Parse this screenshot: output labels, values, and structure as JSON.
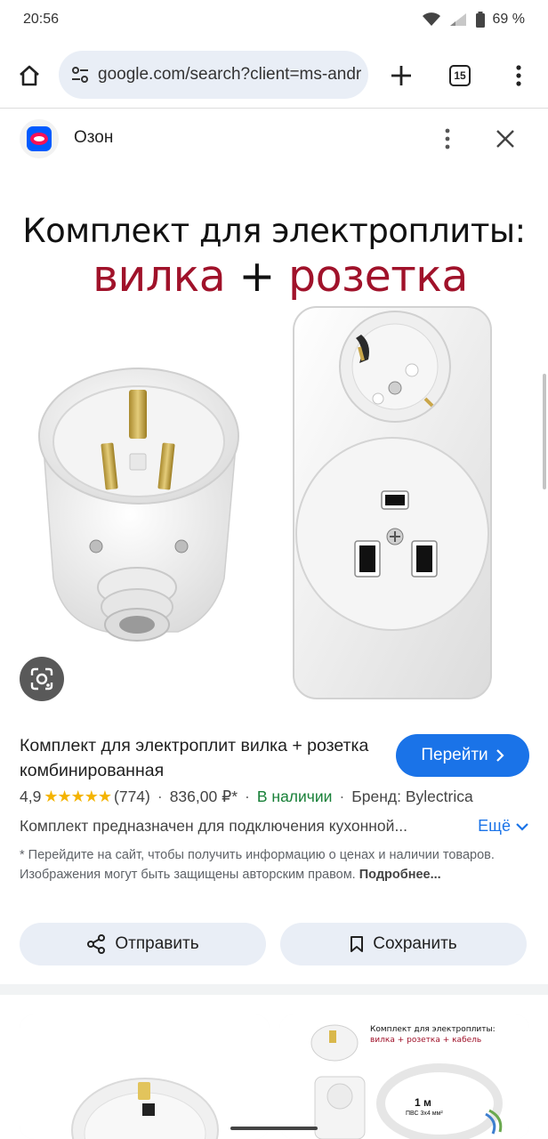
{
  "status_bar": {
    "time": "20:56",
    "battery": "69 %"
  },
  "browser": {
    "url": "google.com/search?client=ms-andr",
    "tab_count": "15"
  },
  "source": {
    "name": "Озон"
  },
  "image": {
    "title_line": "Комплект для электроплиты:",
    "sub_part1": "вилка",
    "sub_plus": " + ",
    "sub_part2": "розетка"
  },
  "product": {
    "title": "Комплект для электроплит вилка + розетка комбинированная",
    "go_label": "Перейти",
    "rating": "4,9",
    "stars": "★★★★★",
    "reviews": "(774)",
    "price": "836,00 ₽*",
    "availability": "В наличии",
    "brand": "Бренд: Bylectrica",
    "description": "Комплект предназначен для подключения кухонной...",
    "more_label": "Ещё"
  },
  "disclaimer": {
    "text": "* Перейдите на сайт, чтобы получить информацию о ценах и наличии товаров. Изображения могут быть защищены авторским правом. ",
    "more": "Подробнее..."
  },
  "actions": {
    "share_label": "Отправить",
    "save_label": "Сохранить"
  },
  "related": {
    "right_title": "Комплект для электроплиты:",
    "right_sub": "вилка + розетка + кабель",
    "right_len": "1 м",
    "right_cable": "ПВС 3х4 мм²"
  },
  "colors": {
    "accent_blue": "#1a73e8",
    "in_stock_green": "#188038",
    "headline_red": "#a0122a",
    "star_yellow": "#f4b400",
    "chip_bg": "#e9eef6"
  },
  "icons": {
    "home": "home-icon",
    "tune": "tune-icon",
    "plus": "plus-icon",
    "tabs": "tabs-icon",
    "menu": "more-vert-icon",
    "close": "close-icon",
    "lens": "lens-icon",
    "share": "share-icon",
    "bookmark": "bookmark-icon",
    "chevron": "chevron-right-icon"
  }
}
